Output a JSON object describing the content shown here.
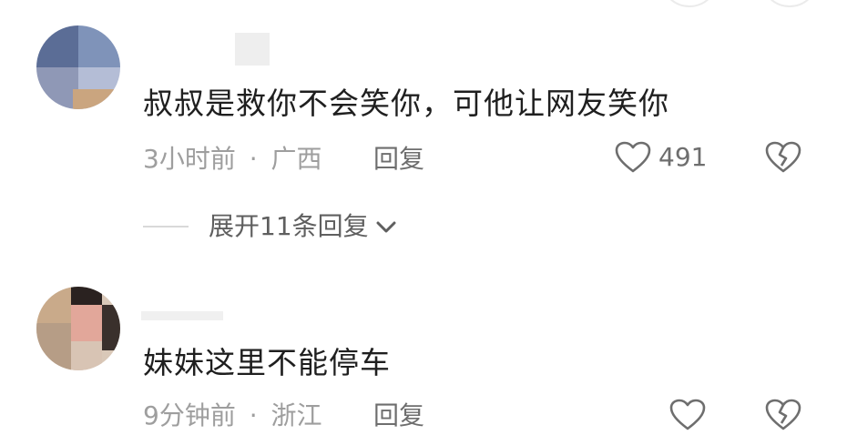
{
  "comments": [
    {
      "text": "叔叔是救你不会笑你，可他让网友笑你",
      "time": "3小时前",
      "separator": "·",
      "location": "广西",
      "reply_label": "回复",
      "likes": "491",
      "expand_label": "展开11条回复"
    },
    {
      "text": "妹妹这里不能停车",
      "time": "9分钟前",
      "separator": "·",
      "location": "浙江",
      "reply_label": "回复"
    }
  ],
  "icons": {
    "like": "heart-outline-icon",
    "dislike": "broken-heart-icon",
    "expand": "chevron-down-icon"
  },
  "colors": {
    "text": "#1f1f1f",
    "meta": "#9e9e9e",
    "action": "#6e6e6e"
  }
}
